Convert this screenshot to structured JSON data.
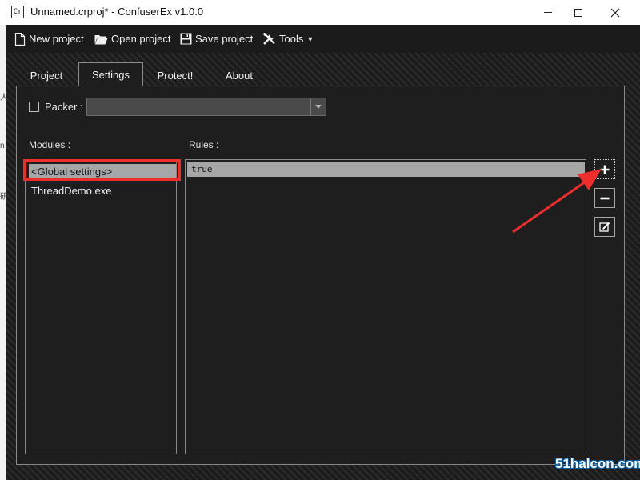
{
  "window": {
    "icon_text": "Cr",
    "title": "Unnamed.crproj* - ConfuserEx v1.0.0"
  },
  "background_app": {
    "fragments": [
      "人",
      "n",
      "研"
    ]
  },
  "toolbar": {
    "new_project": "New project",
    "open_project": "Open project",
    "save_project": "Save project",
    "tools": "Tools"
  },
  "tabs": [
    {
      "label": "Project",
      "active": false
    },
    {
      "label": "Settings",
      "active": true
    },
    {
      "label": "Protect!",
      "active": false
    },
    {
      "label": "About",
      "active": false
    }
  ],
  "settings": {
    "packer_label": "Packer :",
    "packer_checked": false,
    "packer_value": "",
    "modules_label": "Modules :",
    "rules_label": "Rules :",
    "modules": [
      {
        "label": "<Global settings>",
        "selected": true
      },
      {
        "label": "ThreadDemo.exe",
        "selected": false
      }
    ],
    "rules": [
      {
        "label": "true",
        "selected": true
      }
    ]
  },
  "annotation": {
    "highlight_color": "#ef2d2d",
    "arrow_color": "#ef2d2d"
  },
  "watermark": "51halcon.com"
}
